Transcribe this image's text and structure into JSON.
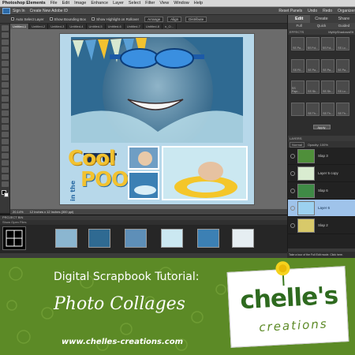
{
  "menubar": {
    "app_name": "Photoshop Elements",
    "items": [
      "File",
      "Edit",
      "Image",
      "Enhance",
      "Layer",
      "Select",
      "Filter",
      "View",
      "Window",
      "Help"
    ]
  },
  "appbar": {
    "sign_in": "Sign In",
    "create_id": "Create New Adobe ID",
    "reset_panels": "Reset Panels",
    "undo": "Undo",
    "redo": "Redo",
    "organizer": "Organizer"
  },
  "options": {
    "auto_select": "Auto Select Layer",
    "bounding_box": "Show Bounding Box",
    "highlight": "Show Highlight on Rollover",
    "arrange": "Arrange",
    "align": "Align",
    "distribute": "Distribute"
  },
  "document_tabs": [
    "Untitled-1",
    "Untitled-2",
    "Untitled-3",
    "Untitled-4",
    "Untitled-5",
    "Untitled-6",
    "Untitled-7",
    "Untitled-8",
    "n_O..."
  ],
  "status": {
    "zoom": "20.14%",
    "doc_size": "12 Inches x 12 Inches (300 ppi)"
  },
  "layout_title": {
    "word1": "Cool",
    "word2": "in the",
    "word3": "POOL"
  },
  "right_panel": {
    "tabs": [
      "Edit",
      "Create",
      "Share"
    ],
    "subtabs": [
      "Full",
      "Quick",
      "Guided"
    ],
    "effects_header": "EFFECTS",
    "effects_filter": "MyMyShadowsElt",
    "effects": [
      "SS Pa...",
      "SS Fol...",
      "SS Fol...",
      "SS Lo...",
      "SS Fil...",
      "SS Pa...",
      "SS Pa...",
      "SS Pa...",
      "SS Papr...",
      "SS Sk...",
      "SS Sh...",
      "SS Lo...",
      "",
      "SS Th...",
      "SS Th...",
      "SS Th..."
    ],
    "apply": "Apply",
    "layers_header": "LAYERS",
    "blend": "Normal",
    "opacity": "Opacity: 100%",
    "layers": [
      {
        "name": "Slap 3",
        "color": "#4f8f3a",
        "active": false
      },
      {
        "name": "Layer 5 copy",
        "color": "#d9ecd0",
        "active": false
      },
      {
        "name": "Slap 6",
        "color": "#3f8a46",
        "active": false
      },
      {
        "name": "Layer 6",
        "color": "#9cd1f0",
        "active": true
      },
      {
        "name": "Slap 2",
        "color": "#d8c96a",
        "active": false
      }
    ]
  },
  "bin": {
    "header": "PROJECT BIN",
    "options": "Show Open Files",
    "hint": "Take a tour of the Full Edit mode. Click here."
  },
  "promo": {
    "title": "Digital Scrapbook Tutorial:",
    "subtitle": "Photo Collages",
    "url": "www.chelles-creations.com",
    "logo_top": "chelle's",
    "logo_bottom": "creations"
  },
  "colors": {
    "banner_green": "#5c8a26",
    "logo_green": "#2e6a1f",
    "title_yellow": "#f2c230",
    "title_blue": "#2e6ea6"
  }
}
